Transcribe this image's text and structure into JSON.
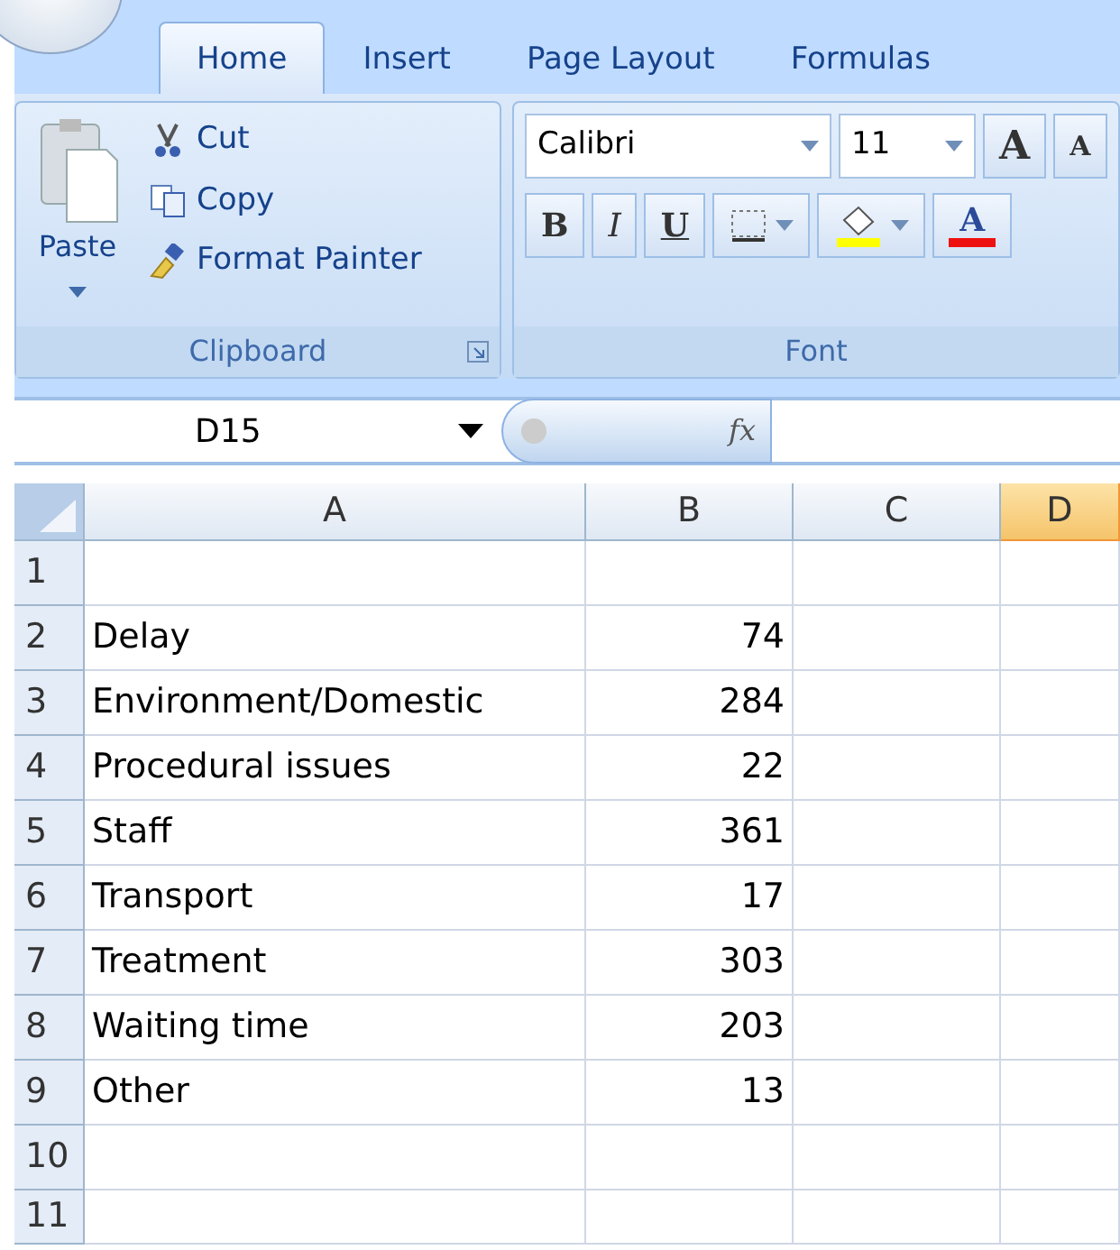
{
  "tabs": [
    {
      "label": "Home",
      "selected": true
    },
    {
      "label": "Insert",
      "selected": false
    },
    {
      "label": "Page Layout",
      "selected": false
    },
    {
      "label": "Formulas",
      "selected": false
    }
  ],
  "clipboard": {
    "paste": "Paste",
    "actions": [
      {
        "kind": "cut",
        "label": "Cut"
      },
      {
        "kind": "copy",
        "label": "Copy"
      },
      {
        "kind": "painter",
        "label": "Format Painter"
      }
    ],
    "title": "Clipboard"
  },
  "font": {
    "name": "Calibri",
    "size": "11",
    "grow": "A",
    "shrink": "A",
    "bold": "B",
    "italic": "I",
    "underline": "U",
    "color_letter": "A",
    "title": "Font"
  },
  "name_box": "D15",
  "formula_label": "fx",
  "columns": [
    {
      "label": "A",
      "selected": false
    },
    {
      "label": "B",
      "selected": false
    },
    {
      "label": "C",
      "selected": false
    },
    {
      "label": "D",
      "selected": true
    }
  ],
  "rows": [
    {
      "number": "1"
    },
    {
      "number": "2",
      "a": "Delay",
      "b": "74"
    },
    {
      "number": "3",
      "a": "Environment/Domestic",
      "b": "284"
    },
    {
      "number": "4",
      "a": "Procedural issues",
      "b": "22"
    },
    {
      "number": "5",
      "a": "Staff",
      "b": "361"
    },
    {
      "number": "6",
      "a": "Transport",
      "b": "17"
    },
    {
      "number": "7",
      "a": "Treatment",
      "b": "303"
    },
    {
      "number": "8",
      "a": "Waiting time",
      "b": "203"
    },
    {
      "number": "9",
      "a": "Other",
      "b": "13"
    },
    {
      "number": "10"
    },
    {
      "number": "11"
    }
  ]
}
